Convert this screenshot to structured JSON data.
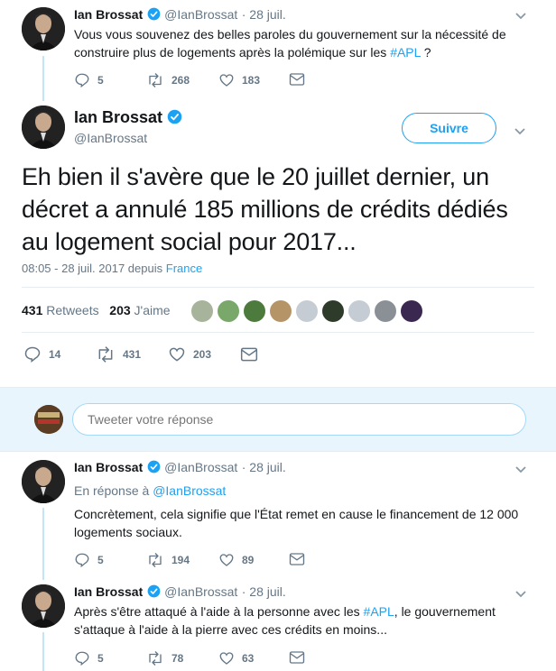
{
  "tweet1": {
    "name": "Ian Brossat",
    "handle": "@IanBrossat",
    "date": "· 28 juil.",
    "text": "Vous vous souvenez des belles paroles du gouvernement sur la nécessité de construire plus de logements après la polémique sur les ",
    "hashtag": "#APL",
    "text_end": " ?",
    "replies": "5",
    "retweets": "268",
    "likes": "183"
  },
  "main": {
    "name": "Ian Brossat",
    "handle": "@IanBrossat",
    "follow_label": "Suivre",
    "text": "Eh bien il s'avère que le 20 juillet dernier, un décret a annulé 185 millions de crédits dédiés au logement social pour 2017...",
    "timestamp": "08:05 - 28 juil. 2017 depuis",
    "location": "France",
    "retweet_count": "431",
    "retweet_label": "Retweets",
    "like_count": "203",
    "like_label": "J'aime",
    "replies": "14",
    "retweets": "431",
    "likes": "203"
  },
  "reply_box": {
    "placeholder": "Tweeter votre réponse"
  },
  "reply1": {
    "name": "Ian Brossat",
    "handle": "@IanBrossat",
    "date": "· 28 juil.",
    "in_reply_prefix": "En réponse à",
    "in_reply_handle": "@IanBrossat",
    "text": "Concrètement, cela signifie que l'État remet en cause le financement de 12 000 logements sociaux.",
    "replies": "5",
    "retweets": "194",
    "likes": "89"
  },
  "reply2": {
    "name": "Ian Brossat",
    "handle": "@IanBrossat",
    "date": "· 28 juil.",
    "text_start": "Après s'être attaqué à l'aide à la personne avec les ",
    "hashtag": "#APL",
    "text_end": ", le gouvernement s'attaque à l'aide à la pierre avec ces crédits en moins...",
    "replies": "5",
    "retweets": "78",
    "likes": "63"
  },
  "colors": {
    "accent": "#1da1f2",
    "secondary": "#657786",
    "text": "#14171a",
    "thread_line": "#c4e4f8"
  },
  "icons": [
    "reply-icon",
    "retweet-icon",
    "like-icon",
    "dm-icon",
    "verified-icon",
    "chevron-down-icon"
  ]
}
